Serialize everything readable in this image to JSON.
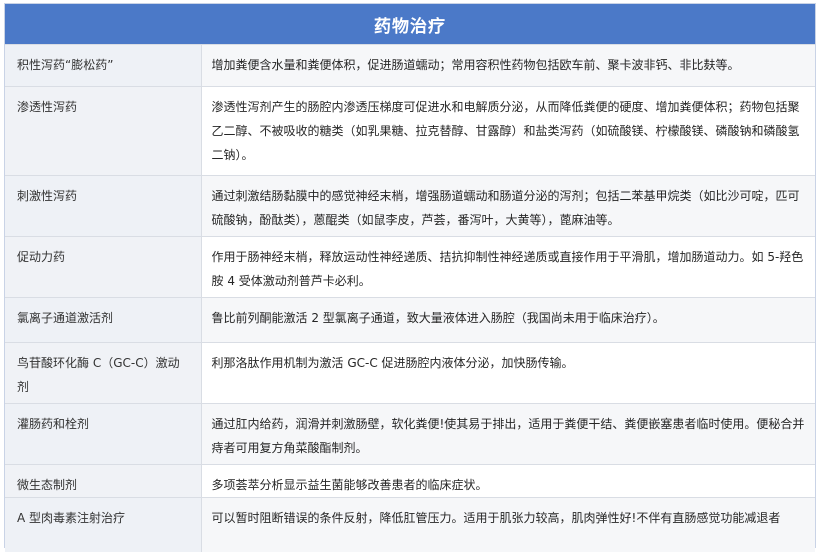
{
  "title": "药物治疗",
  "rows": [
    {
      "name": "积性泻药“膨松药”",
      "desc": "增加粪便含水量和粪便体积，促进肠道蠕动；常用容积性药物包括欧车前、聚卡波非钙、非比麸等。"
    },
    {
      "name": "渗透性泻药",
      "desc": "渗透性泻剂产生的肠腔内渗透压梯度可促进水和电解质分泌，从而降低粪便的硬度、增加粪便体积；药物包括聚乙二醇、不被吸收的糖类（如乳果糖、拉克替醇、甘露醇）和盐类泻药（如硫酸镁、柠檬酸镁、磷酸钠和磷酸氢二钠）。"
    },
    {
      "name": "刺激性泻药",
      "desc": "通过刺激结肠黏膜中的感觉神经末梢，增强肠道蠕动和肠道分泌的泻剂；包括二苯基甲烷类（如比沙可啶，匹可硫酸钠，酚酞类），蒽醌类（如鼠李皮，芦荟，番泻叶，大黄等），蓖麻油等。"
    },
    {
      "name": "促动力药",
      "desc": "作用于肠神经末梢，释放运动性神经递质、拮抗抑制性神经递质或直接作用于平滑肌，增加肠道动力。如 5-羟色胺 4 受体激动剂普芦卡必利。"
    },
    {
      "name": "氯离子通道激活剂",
      "desc": "鲁比前列酮能激活 2 型氯离子通道，致大量液体进入肠腔（我国尚未用于临床治疗）。"
    },
    {
      "name": "鸟苷酸环化酶 C（GC-C）激动剂",
      "desc": "利那洛肽作用机制为激活 GC-C 促进肠腔内液体分泌，加快肠传输。"
    },
    {
      "name": "灌肠药和栓剂",
      "desc": "通过肛内给药，润滑并刺激肠壁，软化粪便!使其易于排出，适用于粪便干结、粪便嵌塞患者临时使用。便秘合并痔者可用复方角菜酸酯制剂。"
    },
    {
      "name": "微生态制剂",
      "desc": "多项荟萃分析显示益生菌能够改善患者的临床症状。"
    },
    {
      "name": "A 型肉毒素注射治疗",
      "desc": "可以暂时阻断错误的条件反射，降低肛管压力。适用于肌张力较高，肌肉弹性好!不伴有直肠感觉功能减退者"
    }
  ]
}
